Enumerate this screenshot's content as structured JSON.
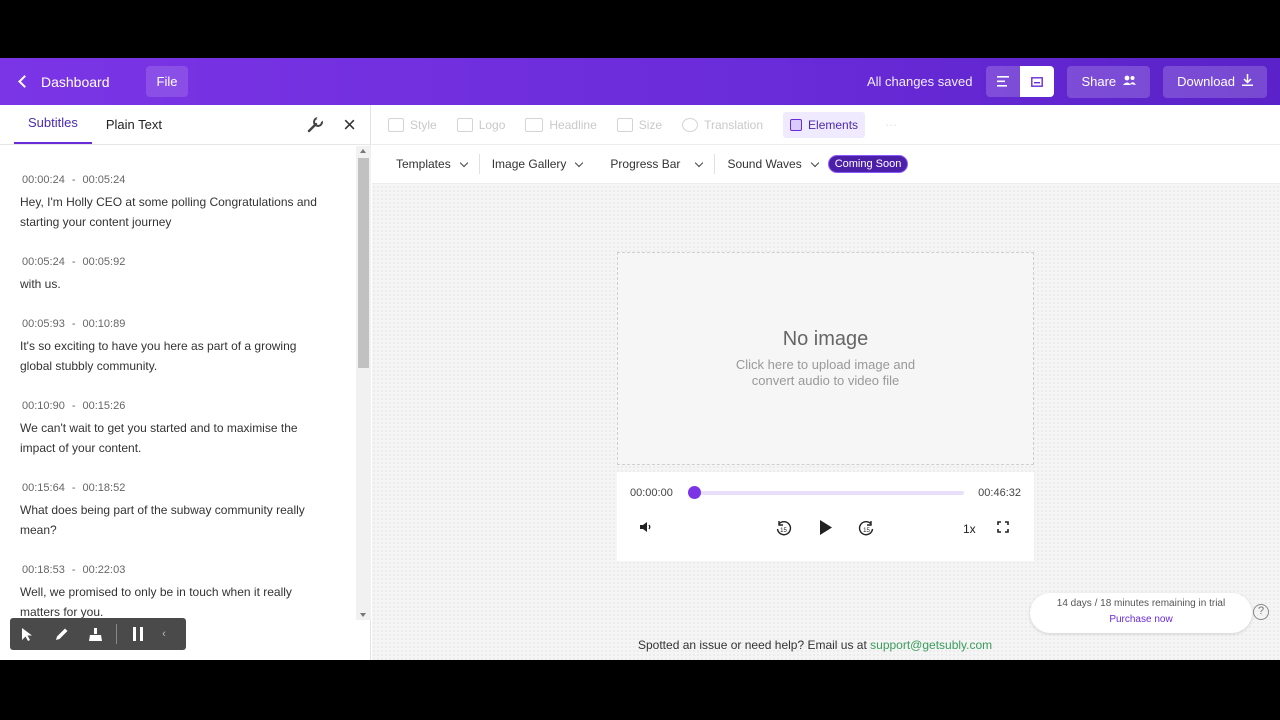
{
  "topbar": {
    "back_label": "Dashboard",
    "file_label": "File",
    "saved_status": "All changes saved",
    "share_label": "Share",
    "download_label": "Download"
  },
  "left_panel": {
    "tabs": [
      "Subtitles",
      "Plain Text"
    ],
    "subtitles": [
      {
        "start": "00:00:24",
        "end": "00:05:24",
        "text": "Hey, I'm Holly CEO at some polling Congratulations and starting your content journey"
      },
      {
        "start": "00:05:24",
        "end": "00:05:92",
        "text": "with us."
      },
      {
        "start": "00:05:93",
        "end": "00:10:89",
        "text": "It's so exciting to have you here as part of a growing global stubbly community."
      },
      {
        "start": "00:10:90",
        "end": "00:15:26",
        "text": "We can't wait to get you started and to maximise the impact of your content."
      },
      {
        "start": "00:15:64",
        "end": "00:18:52",
        "text": "What does being part of the subway community really mean?"
      },
      {
        "start": "00:18:53",
        "end": "00:22:03",
        "text": "Well, we promised to only be in touch when it really matters for you."
      }
    ]
  },
  "style_tabs": [
    "Style",
    "Logo",
    "Headline",
    "Size",
    "Translation",
    "Elements"
  ],
  "element_tabs": {
    "templates": "Templates",
    "image_gallery": "Image Gallery",
    "progress_bar": "Progress Bar",
    "sound_waves": "Sound Waves",
    "coming_soon": "Coming Soon"
  },
  "canvas": {
    "title": "No image",
    "subtitle": "Click here to upload image and convert audio to video file"
  },
  "player": {
    "current_time": "00:00:00",
    "total_time": "00:46:32",
    "progress": 0.0,
    "speed": "1x",
    "skip_back": "15",
    "skip_forward": "15"
  },
  "footer": {
    "help_text": "Spotted an issue or need help? Email us at ",
    "help_email": "support@getsubly.com"
  },
  "trial": {
    "remaining": "14 days / 18 minutes remaining in trial",
    "purchase": "Purchase now"
  },
  "colors": {
    "brand": "#6a2bd8",
    "link_green": "#3a9d5d",
    "coming_soon_bg": "#4b1fa8"
  }
}
